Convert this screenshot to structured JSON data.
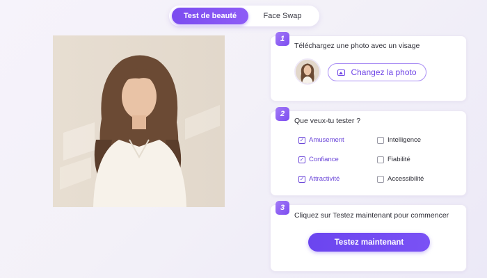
{
  "tabs": {
    "active": "Test de beauté",
    "inactive": "Face Swap"
  },
  "steps": [
    {
      "number": "1",
      "title": "Téléchargez une photo avec un visage",
      "button_label": "Changez la photo",
      "button_icon": "image-icon"
    },
    {
      "number": "2",
      "title": "Que veux-tu tester ?"
    },
    {
      "number": "3",
      "title": "Cliquez sur Testez maintenant pour commencer",
      "button_label": "Testez maintenant"
    }
  ],
  "options": {
    "left": [
      {
        "label": "Amusement",
        "checked": true
      },
      {
        "label": "Confiance",
        "checked": true
      },
      {
        "label": "Attractivité",
        "checked": true
      }
    ],
    "right": [
      {
        "label": "Intelligence",
        "checked": false
      },
      {
        "label": "Fiabilité",
        "checked": false
      },
      {
        "label": "Accessibilité",
        "checked": false
      }
    ]
  },
  "colors": {
    "accent": "#7b4cf0",
    "checked_text": "#6a45d8",
    "background": "#f3f1f8"
  }
}
